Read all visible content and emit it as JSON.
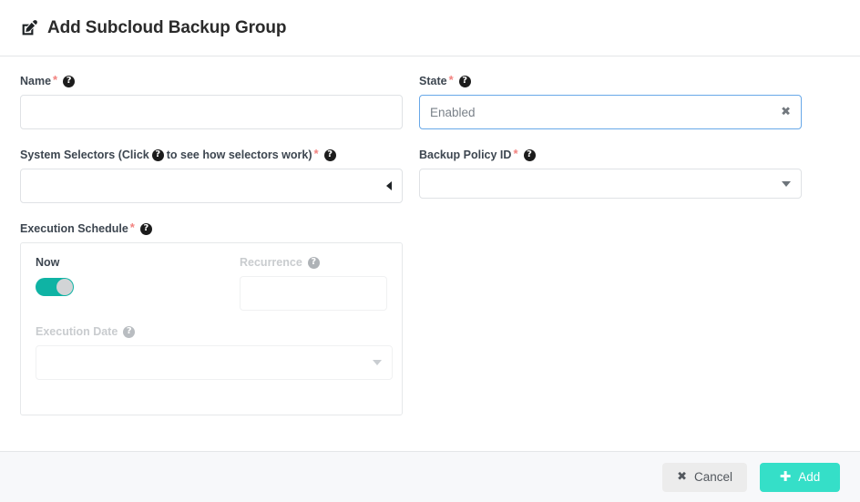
{
  "header": {
    "title": "Add Subcloud Backup Group",
    "icon": "edit-square-pencil-icon"
  },
  "form": {
    "name": {
      "label": "Name",
      "required_mark": "*",
      "help_icon": "?",
      "value": "",
      "placeholder": ""
    },
    "state": {
      "label": "State",
      "required_mark": "*",
      "help_icon": "?",
      "value": "Enabled",
      "clear_icon": "✖",
      "focused": true
    },
    "system_selectors": {
      "label_part1": "System Selectors (Click",
      "label_part2": "to see how selectors work)",
      "required_mark": "*",
      "help_icon": "?",
      "value": "",
      "caret_icon": "caret-left-icon"
    },
    "backup_policy_id": {
      "label": "Backup Policy ID",
      "required_mark": "*",
      "help_icon": "?",
      "value": "",
      "caret_icon": "caret-down-icon"
    },
    "execution_schedule": {
      "label": "Execution Schedule",
      "required_mark": "*",
      "help_icon": "?",
      "now": {
        "label": "Now",
        "toggle_on": true
      },
      "recurrence": {
        "label": "Recurrence",
        "help_icon": "?",
        "value": "",
        "disabled": true
      },
      "execution_date": {
        "label": "Execution Date",
        "help_icon": "?",
        "value": "",
        "disabled": true,
        "caret_icon": "caret-down-icon"
      }
    }
  },
  "footer": {
    "cancel": {
      "label": "Cancel",
      "icon": "✖"
    },
    "add": {
      "label": "Add",
      "icon": "✚"
    }
  },
  "colors": {
    "accent_teal": "#35dfc8",
    "toggle_on": "#0fb3a4",
    "required_star": "#f2827f",
    "focus_border": "#68a8e8",
    "footer_bg": "#f7f8fa"
  }
}
